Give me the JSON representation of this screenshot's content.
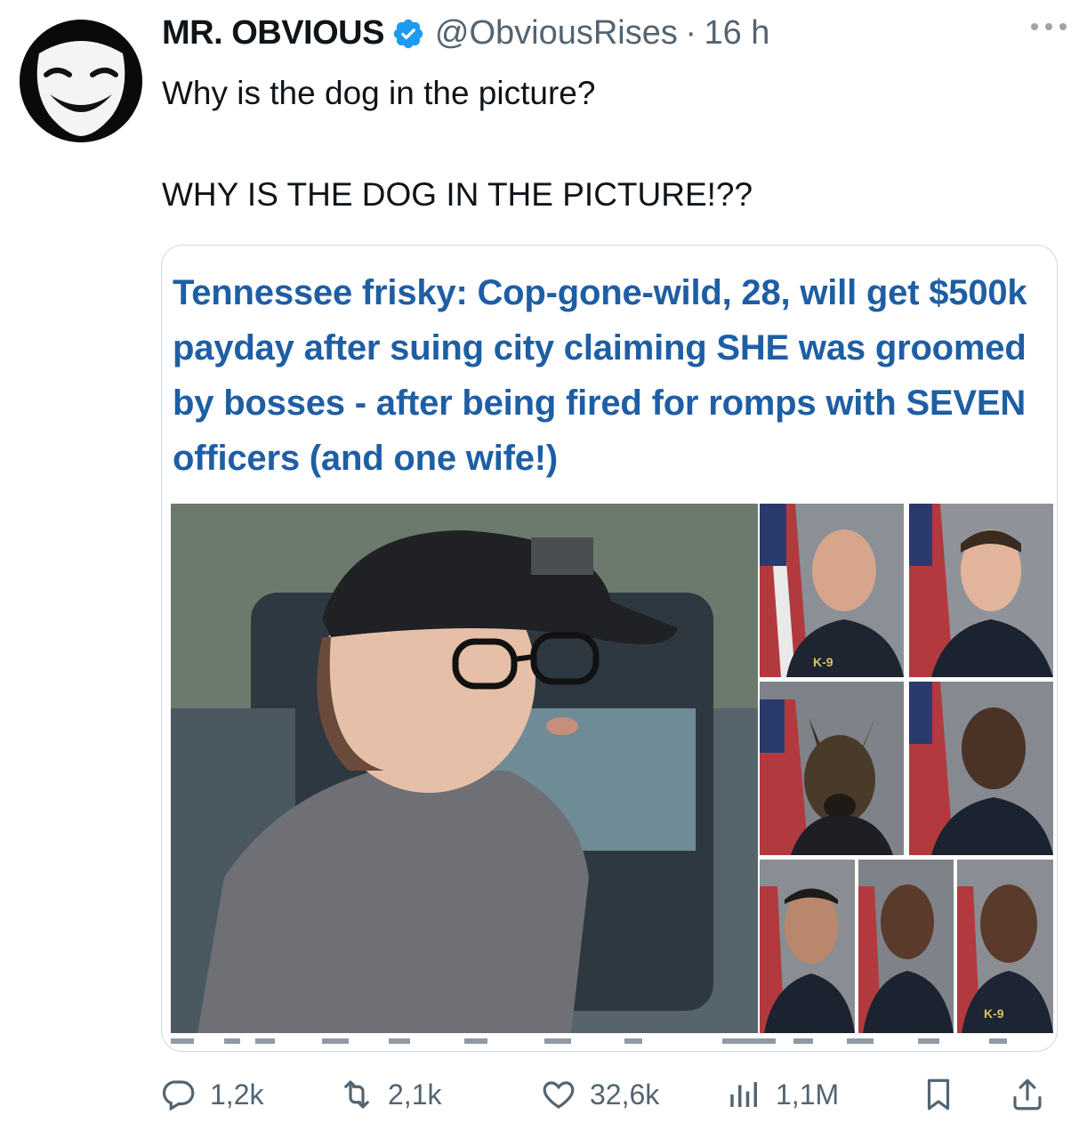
{
  "tweet": {
    "display_name": "MR. OBVIOUS",
    "handle": "@ObviousRises",
    "separator": "·",
    "time": "16 h",
    "line1": "Why is the dog in the picture?",
    "line2": "WHY IS THE DOG IN THE PICTURE!??"
  },
  "card": {
    "headline": "Tennessee frisky: Cop-gone-wild, 28, will get $500k payday after suing city claiming SHE was groomed by bosses - after being fired for romps with SEVEN officers (and one wife!)",
    "badges": [
      "K-9",
      "K-9"
    ]
  },
  "actions": {
    "replies": "1,2k",
    "reposts": "2,1k",
    "likes": "32,6k",
    "views": "1,1M"
  },
  "colors": {
    "headline": "#1e5ea4",
    "verified": "#1d9bf0",
    "muted": "#536471"
  },
  "icons": [
    "reply-icon",
    "repost-icon",
    "like-icon",
    "views-icon",
    "bookmark-icon",
    "share-icon",
    "verified-icon",
    "more-icon"
  ]
}
